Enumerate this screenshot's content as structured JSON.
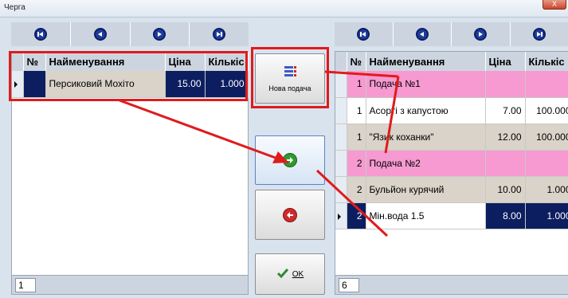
{
  "window": {
    "title": "Черга",
    "close_label": "X"
  },
  "left": {
    "columns": [
      "№",
      "Найменування",
      "Ціна",
      "Кількіс"
    ],
    "rows": [
      {
        "no": "",
        "name": "Персиковий Мохіто",
        "price": "15.00",
        "qty": "1.000"
      }
    ],
    "count": "1"
  },
  "right": {
    "columns": [
      "№",
      "Найменування",
      "Ціна",
      "Кількіс"
    ],
    "rows": [
      {
        "no": "1",
        "name": "Подача №1",
        "price": "",
        "qty": ""
      },
      {
        "no": "1",
        "name": "Асорті з капустою",
        "price": "7.00",
        "qty": "100.000"
      },
      {
        "no": "1",
        "name": "\"Язик коханки\"",
        "price": "12.00",
        "qty": "100.000"
      },
      {
        "no": "2",
        "name": "Подача №2",
        "price": "",
        "qty": ""
      },
      {
        "no": "2",
        "name": "Бульйон курячий",
        "price": "10.00",
        "qty": "1.000"
      },
      {
        "no": "2",
        "name": "Мін.вода 1.5",
        "price": "8.00",
        "qty": "1.000"
      }
    ],
    "count": "6"
  },
  "buttons": {
    "new_serving": "Нова подача",
    "ok": "OK"
  },
  "colors": {
    "highlight": "#e01b1b",
    "serving_row": "#f69ad1",
    "selected_row": "#0d1e60"
  }
}
